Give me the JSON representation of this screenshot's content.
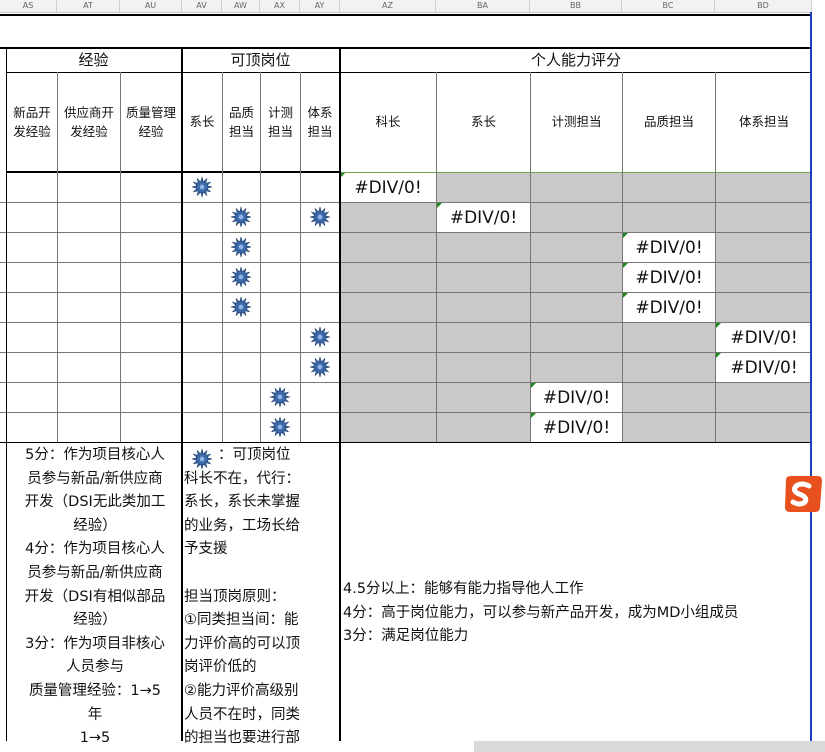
{
  "column_letters": [
    "AS",
    "AT",
    "AU",
    "AV",
    "AW",
    "AX",
    "AY",
    "AZ",
    "BA",
    "BB",
    "BC",
    "BD"
  ],
  "headers": {
    "experience": "经验",
    "substitutable_positions": "可顶岗位",
    "ability_score": "个人能力评分"
  },
  "experience_cols": [
    "新品开发经验",
    "供应商开发经验",
    "质量管理经验"
  ],
  "position_cols": [
    "系长",
    "品质担当",
    "计测担当",
    "体系担当"
  ],
  "score_cols": [
    "科长",
    "系长",
    "计测担当",
    "品质担当",
    "体系担当"
  ],
  "error_value": "#DIV/0!",
  "rows": [
    {
      "stars": [
        0
      ],
      "err_col": 0
    },
    {
      "stars": [
        1,
        3
      ],
      "err_col": 1
    },
    {
      "stars": [
        1
      ],
      "err_col": 3
    },
    {
      "stars": [
        1
      ],
      "err_col": 3
    },
    {
      "stars": [
        1
      ],
      "err_col": 3
    },
    {
      "stars": [
        3
      ],
      "err_col": 4
    },
    {
      "stars": [
        3
      ],
      "err_col": 4
    },
    {
      "stars": [
        2
      ],
      "err_col": 2
    },
    {
      "stars": [
        2
      ],
      "err_col": 2
    }
  ],
  "experience_note": [
    "5分：作为项目核心人",
    "员参与新品/新供应商",
    "开发（DSI无此类加工",
    "经验）",
    "4分：作为项目核心人",
    "员参与新品/新供应商",
    "开发（DSI有相似部品",
    "经验）",
    "3分：作为项目非核心",
    "人员参与",
    "质量管理经验：1→5",
    "年",
    "1→5"
  ],
  "position_note": [
    "：可顶岗位",
    "科长不在，代行：",
    "系长，系长未掌握",
    "的业务，工场长给",
    "予支援",
    "",
    "担当顶岗原则：",
    "①同类担当间：能",
    "力评价高的可以顶",
    "岗评价低的",
    "②能力评价高级别",
    "人员不在时，同类",
    "的担当也要进行部"
  ],
  "score_note": [
    "4.5分以上：能够有能力指导他人工作",
    "4分：高于岗位能力，可以参与新产品开发，成为MD小组成员",
    "3分：满足岗位能力"
  ],
  "colors": {
    "grey_cell": "#c9c9c9",
    "star": "#3c6aa8",
    "logo": "#e8501e"
  }
}
